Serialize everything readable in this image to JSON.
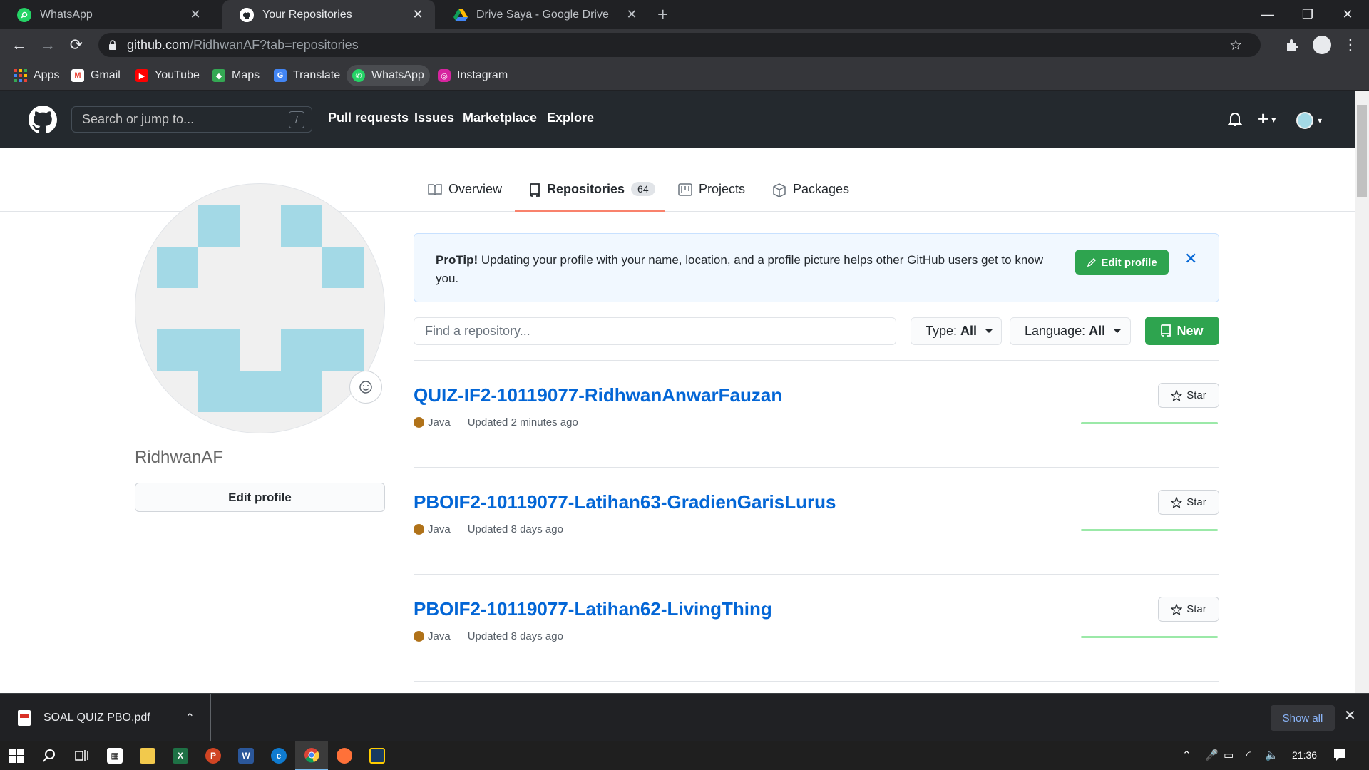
{
  "browser": {
    "tabs": [
      {
        "title": "WhatsApp",
        "icon": "whatsapp-icon",
        "active": false
      },
      {
        "title": "Your Repositories",
        "icon": "github-icon",
        "active": true
      },
      {
        "title": "Drive Saya - Google Drive",
        "icon": "google-drive-icon",
        "active": false
      }
    ],
    "url_host": "github.com",
    "url_path": "/RidhwanAF?tab=repositories",
    "bookmarks": [
      {
        "label": "Apps",
        "icon": "apps-grid-icon"
      },
      {
        "label": "Gmail",
        "icon": "gmail-icon"
      },
      {
        "label": "YouTube",
        "icon": "youtube-icon"
      },
      {
        "label": "Maps",
        "icon": "maps-icon"
      },
      {
        "label": "Translate",
        "icon": "translate-icon"
      },
      {
        "label": "WhatsApp",
        "icon": "whatsapp-icon"
      },
      {
        "label": "Instagram",
        "icon": "instagram-icon"
      }
    ]
  },
  "github": {
    "search_placeholder": "Search or jump to...",
    "search_shortcut": "/",
    "nav": [
      "Pull requests",
      "Issues",
      "Marketplace",
      "Explore"
    ],
    "profile_tabs": [
      {
        "label": "Overview",
        "icon": "book-icon"
      },
      {
        "label": "Repositories",
        "icon": "repo-icon",
        "count": "64",
        "selected": true
      },
      {
        "label": "Projects",
        "icon": "project-icon"
      },
      {
        "label": "Packages",
        "icon": "package-icon"
      }
    ],
    "username": "RidhwanAF",
    "edit_profile_label": "Edit profile",
    "protip": {
      "lead": "ProTip!",
      "text": " Updating your profile with your name, location, and a profile picture helps other GitHub users get to know you.",
      "button": "Edit profile",
      "close": "✕"
    },
    "filter": {
      "find_placeholder": "Find a repository...",
      "type_label": "Type:",
      "type_value": "All",
      "language_label": "Language:",
      "language_value": "All",
      "new_label": "New"
    },
    "repos": [
      {
        "name": "QUIZ-IF2-10119077-RidhwanAnwarFauzan",
        "language": "Java",
        "updated": "Updated 2 minutes ago",
        "star_label": "Star"
      },
      {
        "name": "PBOIF2-10119077-Latihan63-GradienGarisLurus",
        "language": "Java",
        "updated": "Updated 8 days ago",
        "star_label": "Star"
      },
      {
        "name": "PBOIF2-10119077-Latihan62-LivingThing",
        "language": "Java",
        "updated": "Updated 8 days ago",
        "star_label": "Star"
      }
    ],
    "colors": {
      "accent_green": "#2ea44f",
      "link_blue": "#0366d6",
      "java": "#b07219",
      "tab_underline": "#f9826c"
    }
  },
  "downloads": {
    "file": "SOAL QUIZ PBO.pdf",
    "show_all": "Show all"
  },
  "taskbar": {
    "time": "21:36"
  }
}
